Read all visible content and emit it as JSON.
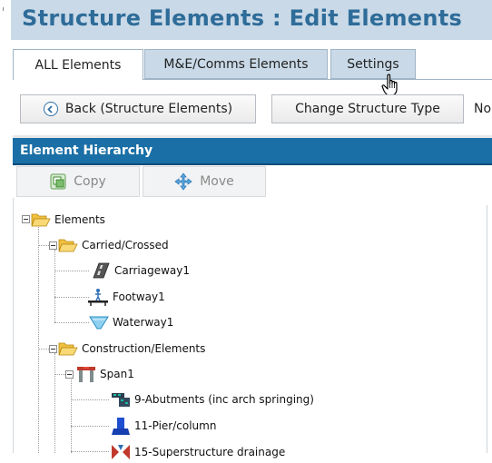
{
  "header": {
    "title": "Structure Elements : Edit Elements"
  },
  "tabs": [
    {
      "label": "ALL Elements",
      "active": true
    },
    {
      "label": "M&E/Comms Elements",
      "active": false
    },
    {
      "label": "Settings",
      "active": false
    }
  ],
  "toolbar": {
    "back_label": "Back (Structure Elements)",
    "change_label": "Change Structure Type",
    "cutoff_text": "No"
  },
  "panel": {
    "title": "Element Hierarchy",
    "copy_label": "Copy",
    "move_label": "Move"
  },
  "tree": {
    "root": "Elements",
    "carried": "Carried/Crossed",
    "carriageway": "Carriageway1",
    "footway": "Footway1",
    "waterway": "Waterway1",
    "construction": "Construction/Elements",
    "span": "Span1",
    "abutments": "9-Abutments (inc arch springing)",
    "pier": "11-Pier/column",
    "drainage": "15-Superstructure drainage"
  },
  "colors": {
    "header_bg": "#c9d9e7",
    "header_text": "#2e6c99",
    "section_bar": "#1a6fa6",
    "folder": "#f5c542"
  }
}
